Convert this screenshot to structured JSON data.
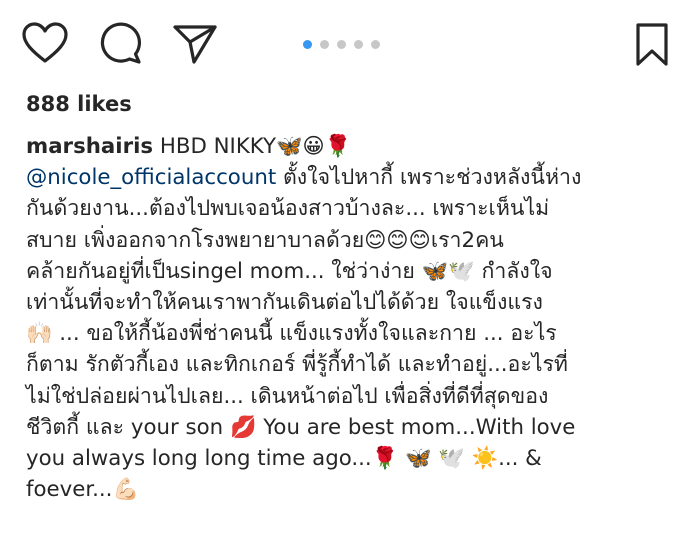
{
  "actions": {
    "like_icon": "heart-outline-icon",
    "comment_icon": "speech-bubble-icon",
    "share_icon": "paper-plane-icon",
    "save_icon": "bookmark-outline-icon"
  },
  "carousel": {
    "total": 5,
    "active_index": 0,
    "active_color": "#3897f0",
    "inactive_color": "#c7c7c7"
  },
  "likes": "888 likes",
  "caption": {
    "username": "marshairis",
    "line1_text": " HBD NIKKY🦋😀🌹",
    "mention": "@nicole_officialaccount",
    "line2_text": " ตั้งใจไปหากี้ เพราะช่วงหลังนี้ห่าง",
    "lines": [
      "กันด้วยงาน...ต้องไปพบเจอน้องสาวบ้างละ... เพราะเห็นไม่",
      "สบาย เพิ่งออกจากโรงพยายาบาลด้วย😊😊😊เรา2คน",
      "คล้ายกันอยู่ที่เป็นsingel mom... ใช่ว่าง่าย 🦋🕊️ กำลังใจ",
      "เท่านั้นที่จะทำให้คนเราพากันเดินต่อไปได้ด้วย ใจแข็งแรง",
      "🙌🏻 ... ขอให้กี้น้องพี่ช่าคนนี้ แข็งแรงทั้งใจและกาย ... อะไร",
      "ก็ตาม รักตัวกี้เอง และทิกเกอร์ พี่รู้กี้ทำได้ และทำอยู่...อะไรที่",
      "ไม่ใช่ปล่อยผ่านไปเลย... เดินหน้าต่อไป เพื่อสิ่งที่ดีที่สุดของ",
      "ชีวิตกี้ และ your son 💋 You are best mom...With love",
      "you always long long time ago...🌹 🦋 🕊️ ☀️... &",
      "foever...💪🏻"
    ]
  },
  "colors": {
    "text": "#262626",
    "mention": "#003569",
    "background": "#ffffff"
  }
}
